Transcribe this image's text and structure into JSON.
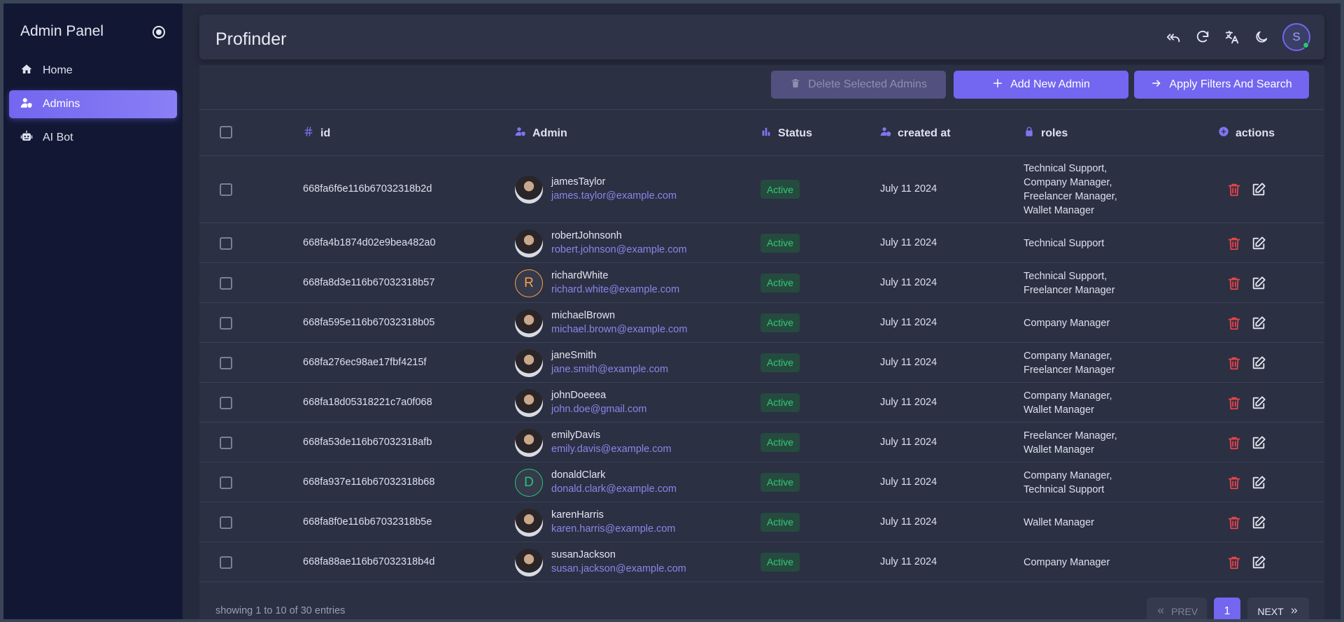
{
  "sidebar": {
    "title": "Admin Panel",
    "items": [
      {
        "label": "Home",
        "icon": "home-icon",
        "active": false
      },
      {
        "label": "Admins",
        "icon": "user-shield-icon",
        "active": true
      },
      {
        "label": "AI Bot",
        "icon": "robot-icon",
        "active": false
      }
    ]
  },
  "header": {
    "title": "Profinder",
    "icons": [
      "reply-all-icon",
      "refresh-icon",
      "translate-icon",
      "moon-icon"
    ],
    "avatar_initial": "S"
  },
  "toolbar": {
    "delete_label": "Delete Selected Admins",
    "add_label": "Add New Admin",
    "apply_label": "Apply Filters And Search"
  },
  "table": {
    "columns": [
      "id",
      "Admin",
      "Status",
      "created at",
      "roles",
      "actions"
    ],
    "rows": [
      {
        "id": "668fa6f6e116b67032318b2d",
        "username": "jamesTaylor",
        "email": "james.taylor@example.com",
        "avatar": "photo",
        "status": "Active",
        "created": "July 11 2024",
        "roles": [
          "Technical Support,",
          "Company Manager,",
          "Freelancer Manager,",
          "Wallet Manager"
        ]
      },
      {
        "id": "668fa4b1874d02e9bea482a0",
        "username": "robertJohnsonh",
        "email": "robert.johnson@example.com",
        "avatar": "photo",
        "status": "Active",
        "created": "July 11 2024",
        "roles": [
          "Technical Support"
        ]
      },
      {
        "id": "668fa8d3e116b67032318b57",
        "username": "richardWhite",
        "email": "richard.white@example.com",
        "avatar": "R",
        "avatar_color": "#ff9f43",
        "status": "Active",
        "created": "July 11 2024",
        "roles": [
          "Technical Support,",
          "Freelancer Manager"
        ]
      },
      {
        "id": "668fa595e116b67032318b05",
        "username": "michaelBrown",
        "email": "michael.brown@example.com",
        "avatar": "photo",
        "status": "Active",
        "created": "July 11 2024",
        "roles": [
          "Company Manager"
        ]
      },
      {
        "id": "668fa276ec98ae17fbf4215f",
        "username": "janeSmith",
        "email": "jane.smith@example.com",
        "avatar": "photo",
        "status": "Active",
        "created": "July 11 2024",
        "roles": [
          "Company Manager,",
          "Freelancer Manager"
        ]
      },
      {
        "id": "668fa18d05318221c7a0f068",
        "username": "johnDoeeea",
        "email": "john.doe@gmail.com",
        "avatar": "photo",
        "status": "Active",
        "created": "July 11 2024",
        "roles": [
          "Company Manager,",
          "Wallet Manager"
        ]
      },
      {
        "id": "668fa53de116b67032318afb",
        "username": "emilyDavis",
        "email": "emily.davis@example.com",
        "avatar": "photo",
        "status": "Active",
        "created": "July 11 2024",
        "roles": [
          "Freelancer Manager,",
          "Wallet Manager"
        ]
      },
      {
        "id": "668fa937e116b67032318b68",
        "username": "donaldClark",
        "email": "donald.clark@example.com",
        "avatar": "D",
        "avatar_color": "#28c76f",
        "status": "Active",
        "created": "July 11 2024",
        "roles": [
          "Company Manager,",
          "Technical Support"
        ]
      },
      {
        "id": "668fa8f0e116b67032318b5e",
        "username": "karenHarris",
        "email": "karen.harris@example.com",
        "avatar": "photo",
        "status": "Active",
        "created": "July 11 2024",
        "roles": [
          "Wallet Manager"
        ]
      },
      {
        "id": "668fa88ae116b67032318b4d",
        "username": "susanJackson",
        "email": "susan.jackson@example.com",
        "avatar": "photo",
        "status": "Active",
        "created": "July 11 2024",
        "roles": [
          "Company Manager"
        ]
      }
    ]
  },
  "footer": {
    "showing": "showing 1 to 10 of 30 entries",
    "prev": "PREV",
    "page": "1",
    "next": "NEXT"
  },
  "colors": {
    "accent": "#7366f0",
    "success": "#28c76f",
    "danger": "#e8454b",
    "sidebar_bg": "#121834",
    "content_bg": "#2b3043"
  }
}
